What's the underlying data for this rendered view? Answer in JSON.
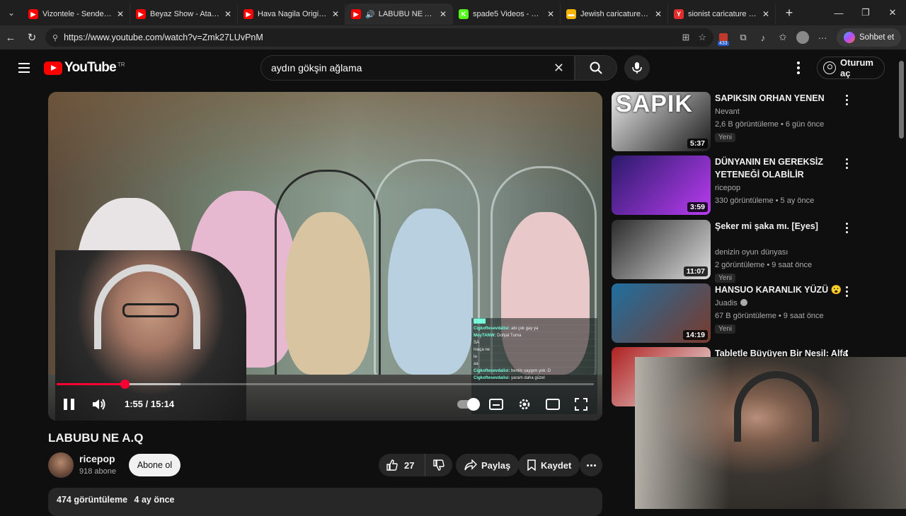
{
  "browser": {
    "tabs": [
      {
        "title": "Vizontele - Sende Bunu",
        "color": "#ff0000",
        "glyph": "▶"
      },
      {
        "title": "Beyaz Show - Atalay Be",
        "color": "#ff0000",
        "glyph": "▶"
      },
      {
        "title": "Hava Nagila Original -",
        "color": "#ff0000",
        "glyph": "▶"
      },
      {
        "title": "LABUBU NE A.Q - Y",
        "color": "#ff0000",
        "glyph": "▶",
        "active": true
      },
      {
        "title": "spade5 Videos - Watch",
        "color": "#53fc18",
        "glyph": "K"
      },
      {
        "title": "Jewish caricature: Görs",
        "color": "#f4b400",
        "glyph": "▬"
      },
      {
        "title": "sionist caricature — Yan",
        "color": "#e02d2d",
        "glyph": "Y"
      }
    ],
    "url": "https://www.youtube.com/watch?v=Zmk27LUvPnM",
    "copilot_label": "Sohbet et",
    "extension_badge": "433"
  },
  "youtube": {
    "logo_text": "YouTube",
    "region": "TR",
    "search_query": "aydın gökşin ağlama",
    "signin_label": "Oturum aç",
    "player": {
      "time": "1:55 / 15:14",
      "progress_played": 0.127,
      "chat": [
        {
          "user": "████",
          "msg": ""
        },
        {
          "user": "Cigkoftesevdalisi:",
          "msg": "abi çok gay ya"
        },
        {
          "user": "MoyTANW:",
          "msg": "Dohjat Turna"
        },
        {
          "user": "",
          "msg": "SA"
        },
        {
          "user": "",
          "msg": "maça ne"
        },
        {
          "user": "",
          "msg": "la"
        },
        {
          "user": "",
          "msg": "aa"
        },
        {
          "user": "Cigkoftesevdalisi:",
          "msg": "benim saygım yok :D"
        },
        {
          "user": "Cigkoftesevdalisi:",
          "msg": "yaram daha güzel"
        }
      ]
    },
    "video": {
      "title": "LABUBU NE A.Q",
      "channel": "ricepop",
      "subscribers": "918 abone",
      "subscribe_label": "Abone ol",
      "likes": "27",
      "share_label": "Paylaş",
      "save_label": "Kaydet",
      "views": "474 görüntüleme",
      "age": "4 ay önce"
    },
    "recommendations": [
      {
        "title": "SAPIKSIN ORHAN YENEN",
        "channel": "Nevant",
        "meta": "2,6 B görüntüleme • 6 gün önce",
        "badge": "Yeni",
        "duration": "5:37",
        "thumb": "SAPIK",
        "colors": [
          "#e8e8e8",
          "#1b1b1b"
        ]
      },
      {
        "title": "DÜNYANIN EN GEREKSİZ YETENEĞİ OLABİLİR",
        "channel": "ricepop",
        "meta": "330 görüntüleme • 5 ay önce",
        "badge": "",
        "duration": "3:59",
        "thumb": "",
        "colors": [
          "#2a1a6a",
          "#b93cf0"
        ]
      },
      {
        "title": "Şeker mi şaka mı.       [Eyes]",
        "channel": "denizin oyun dünyası",
        "meta": "2 görüntüleme • 9 saat önce",
        "badge": "Yeni",
        "duration": "11:07",
        "thumb": "",
        "colors": [
          "#2c2c2c",
          "#dcdcdc"
        ]
      },
      {
        "title": "HANSUO KARANLIK YÜZÜ 😮",
        "channel": "Juadis",
        "meta": "67 B görüntüleme • 9 saat önce",
        "badge": "Yeni",
        "duration": "14:19",
        "thumb": "",
        "colors": [
          "#1f6fa0",
          "#7a3a2c"
        ]
      },
      {
        "title": "Tabletle Büyüyen Bir Nesil: Alfa",
        "channel": "",
        "meta": "",
        "badge": "",
        "duration": "",
        "thumb": "",
        "colors": [
          "#b02020",
          "#eeeeee"
        ]
      }
    ]
  }
}
